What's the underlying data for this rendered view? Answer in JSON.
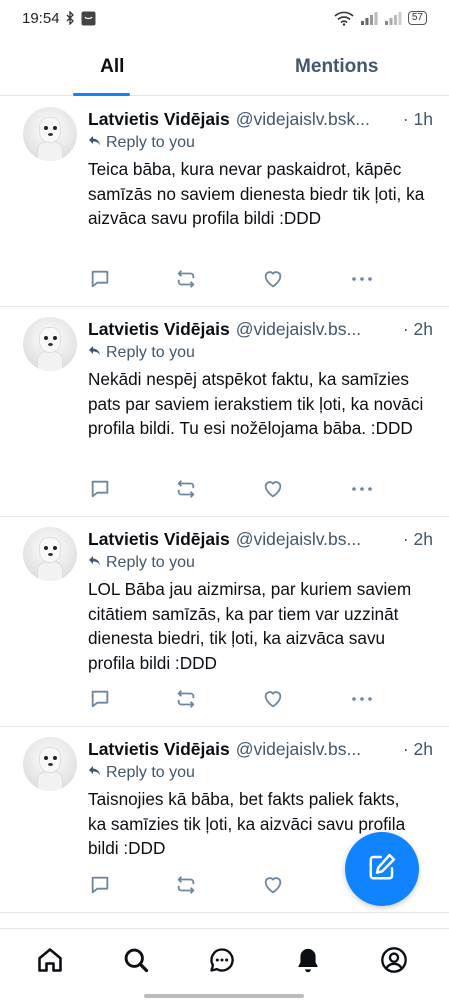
{
  "status_bar": {
    "time": "19:54",
    "battery": "57"
  },
  "tabs": [
    {
      "label": "All",
      "active": true
    },
    {
      "label": "Mentions",
      "active": false
    }
  ],
  "posts": [
    {
      "name": "Latvietis Vidējais",
      "handle": "@videjaislv.bsk...",
      "time": "· 1h",
      "reply_label": "Reply to you",
      "text": "Teica bāba, kura nevar paskaidrot, kāpēc samīzās no saviem dienesta biedr tik ļoti, ka aizvāca savu profila bildi :DDD"
    },
    {
      "name": "Latvietis Vidējais",
      "handle": "@videjaislv.bs...",
      "time": "· 2h",
      "reply_label": "Reply to you",
      "text": "Nekādi nespēj atspēkot faktu, ka samīzies pats par saviem ierakstiem tik ļoti, ka novāci profila bildi. Tu esi nožēlojama bāba. :DDD"
    },
    {
      "name": "Latvietis Vidējais",
      "handle": "@videjaislv.bs...",
      "time": "· 2h",
      "reply_label": "Reply to you",
      "text": "LOL Bāba jau aizmirsa, par kuriem saviem citātiem samīzās, ka par tiem var uzzināt dienesta biedri, tik ļoti, ka aizvāca savu profila bildi :DDD"
    },
    {
      "name": "Latvietis Vidējais",
      "handle": "@videjaislv.bs...",
      "time": "· 2h",
      "reply_label": "Reply to you",
      "text": "Taisnojies kā bāba, bet fakts paliek fakts, ka samīzies tik ļoti, ka aizvāci savu profila bildi :DDD"
    }
  ],
  "icons": {
    "compose": "pencil-square-icon",
    "nav": [
      "home-icon",
      "search-icon",
      "chat-icon",
      "bell-icon",
      "profile-icon"
    ]
  },
  "colors": {
    "accent": "#1083fe",
    "muted": "#42576c",
    "icon": "#6f869f"
  }
}
